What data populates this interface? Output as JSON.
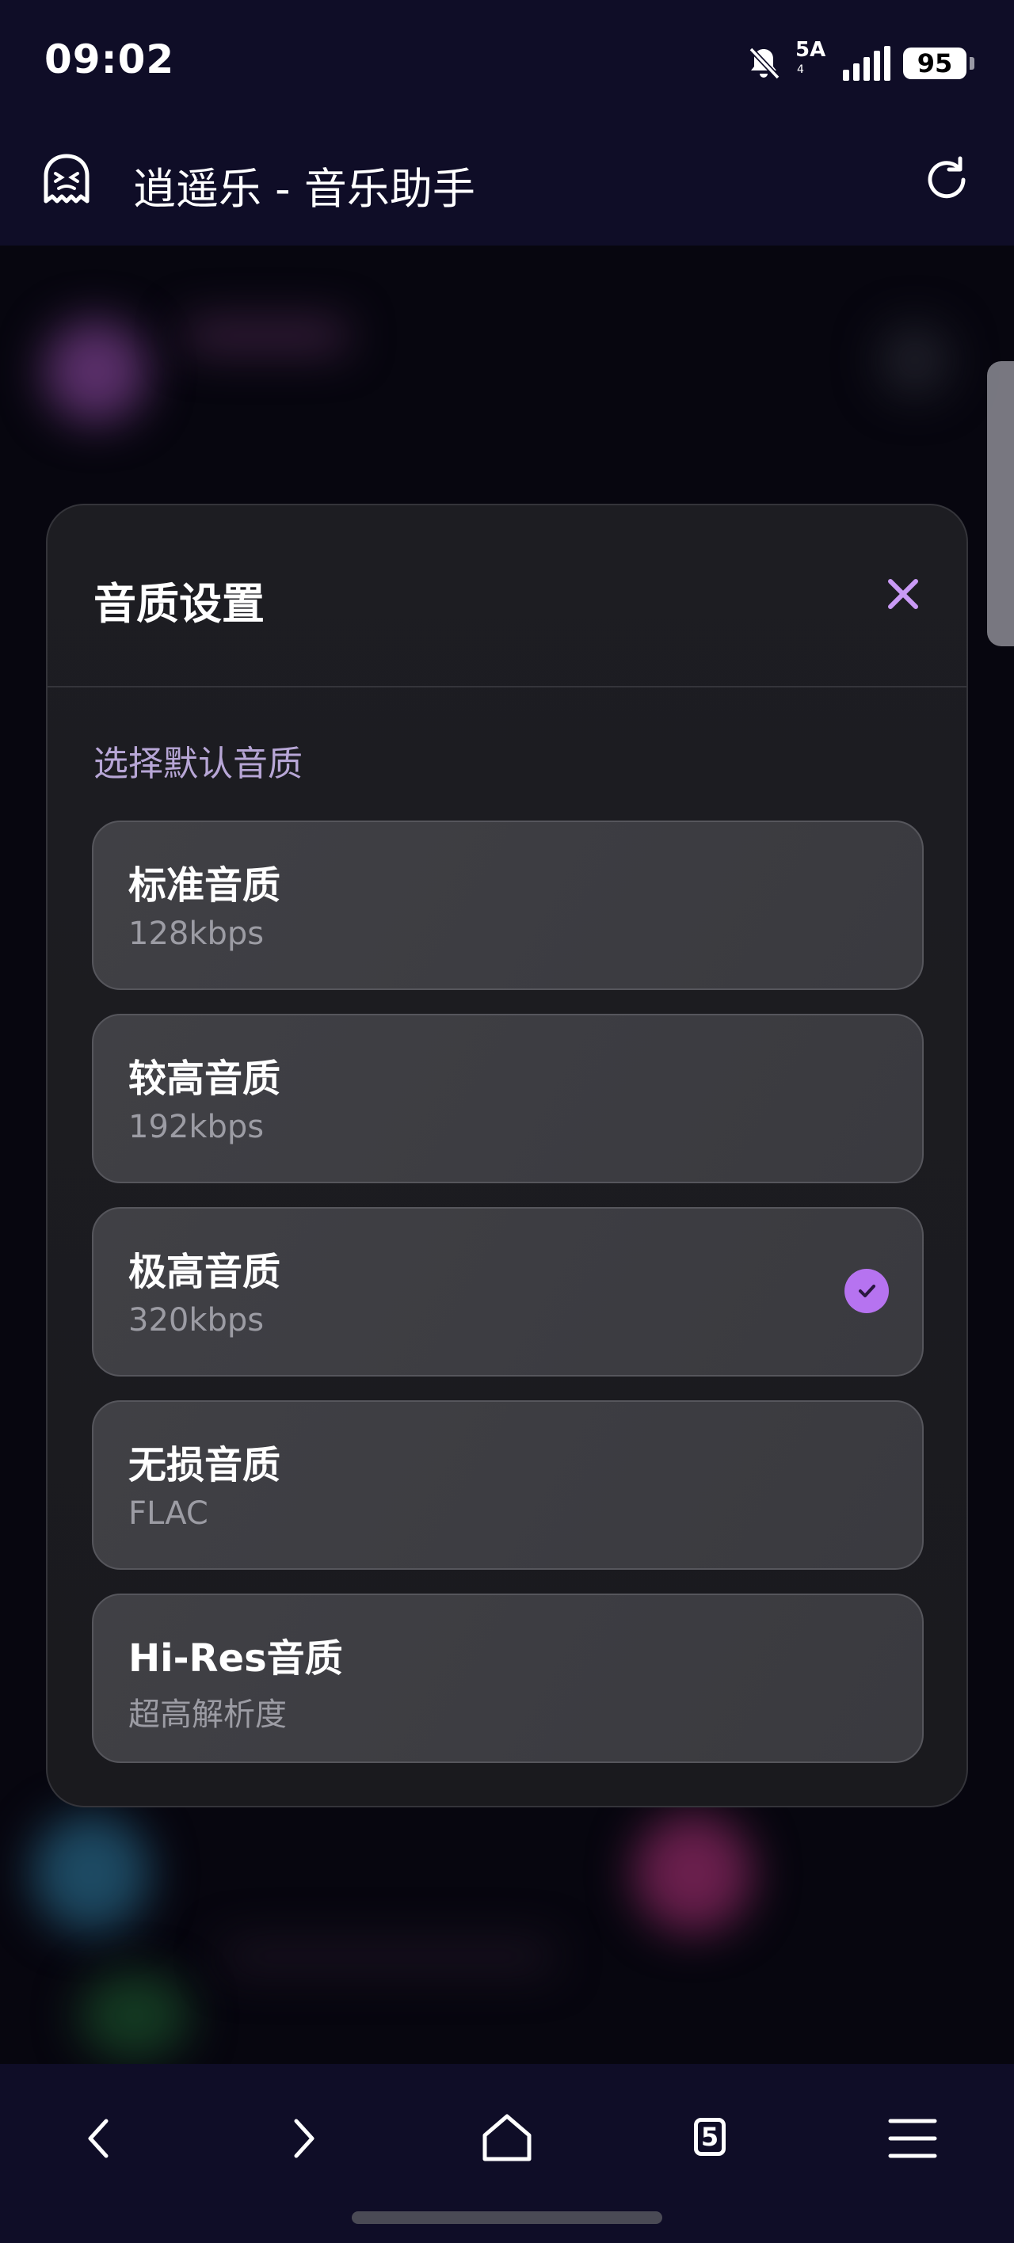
{
  "status_bar": {
    "time": "09:02",
    "network": "5A",
    "network_sub": "4",
    "battery": "95"
  },
  "app_bar": {
    "title": "逍遥乐 - 音乐助手",
    "icon": "ghost-icon",
    "refresh_icon": "refresh-icon"
  },
  "dialog": {
    "title": "音质设置",
    "close_icon": "close-icon",
    "section_label": "选择默认音质",
    "accent_color": "#b673f0",
    "options": [
      {
        "name": "标准音质",
        "detail": "128kbps",
        "selected": false
      },
      {
        "name": "较高音质",
        "detail": "192kbps",
        "selected": false
      },
      {
        "name": "极高音质",
        "detail": "320kbps",
        "selected": true
      },
      {
        "name": "无损音质",
        "detail": "FLAC",
        "selected": false
      },
      {
        "name": "Hi-Res音质",
        "detail": "超高解析度",
        "selected": false
      }
    ]
  },
  "bottom_nav": {
    "items": [
      "back-icon",
      "forward-icon",
      "home-icon",
      "tabs-icon",
      "menu-icon"
    ],
    "tabs_count": "5"
  }
}
